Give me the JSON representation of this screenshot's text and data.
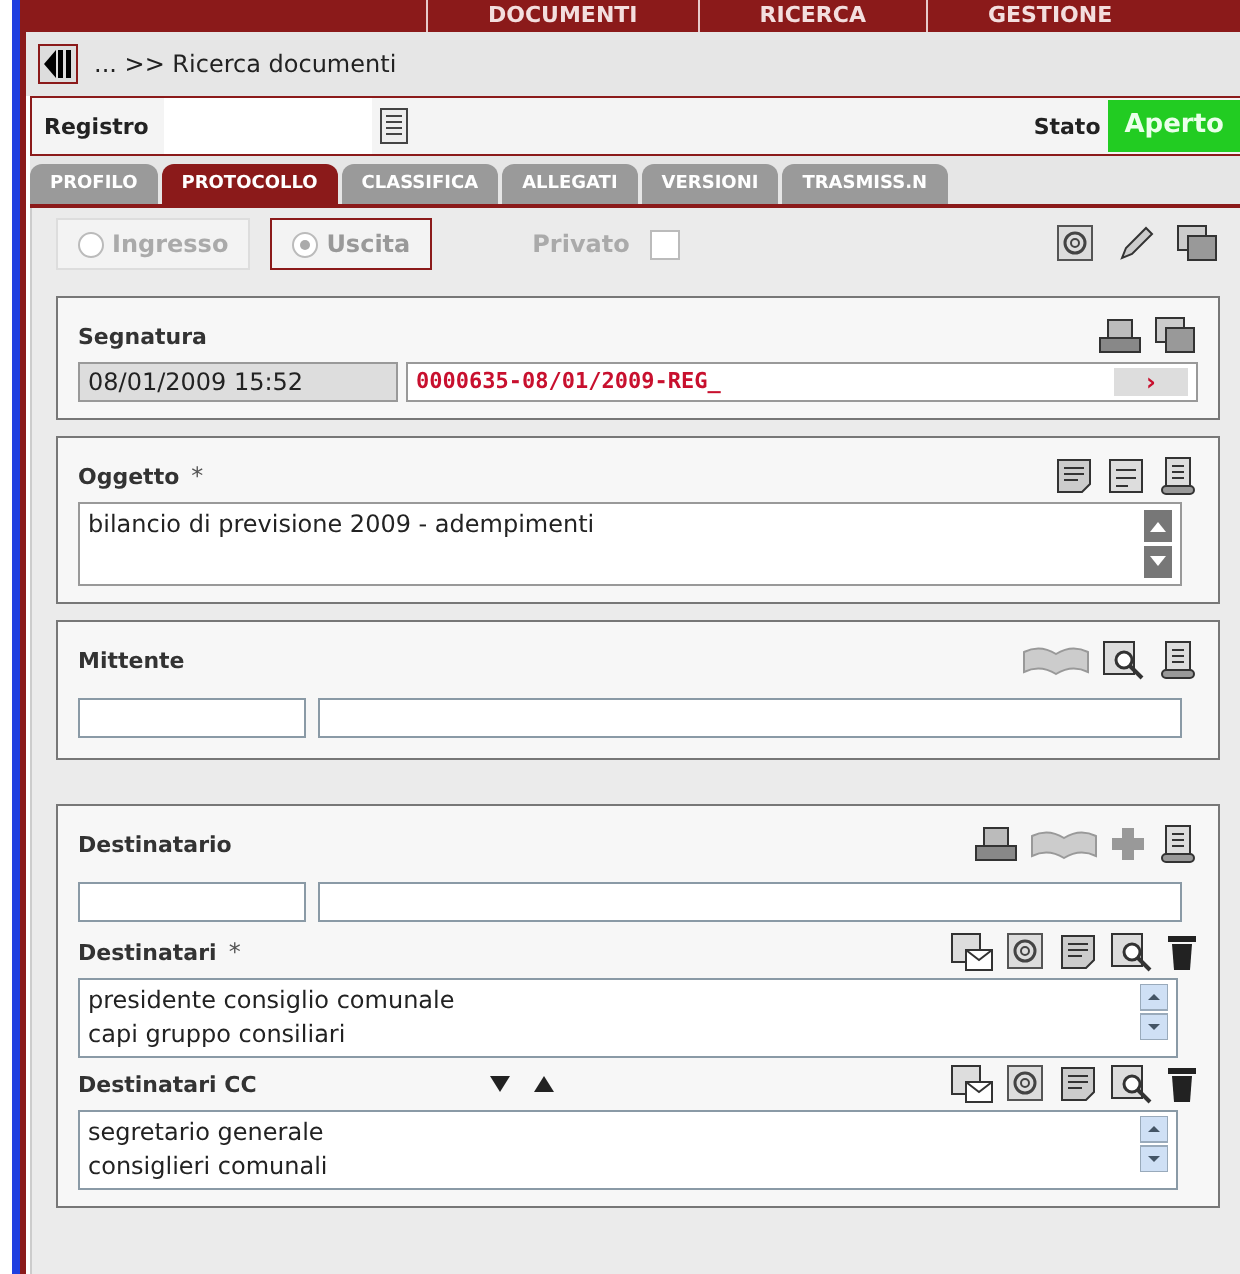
{
  "top_menu": [
    "DOCUMENTI",
    "RICERCA",
    "GESTIONE"
  ],
  "breadcrumb": "... >> Ricerca documenti",
  "registro": {
    "label": "Registro"
  },
  "stato": {
    "label": "Stato",
    "value": "Aperto"
  },
  "tabs": [
    {
      "label": "PROFILO",
      "selected": false
    },
    {
      "label": "PROTOCOLLO",
      "selected": true
    },
    {
      "label": "CLASSIFICA",
      "selected": false
    },
    {
      "label": "ALLEGATI",
      "selected": false
    },
    {
      "label": "VERSIONI",
      "selected": false
    },
    {
      "label": "TRASMISS.N",
      "selected": false
    }
  ],
  "direction": [
    {
      "label": "Ingresso",
      "selected": false
    },
    {
      "label": "Uscita",
      "selected": true
    }
  ],
  "privato": {
    "label": "Privato",
    "checked": false
  },
  "segnatura": {
    "label": "Segnatura",
    "date": "08/01/2009 15:52",
    "number": "0000635-08/01/2009-REG_",
    "marker": "›"
  },
  "oggetto": {
    "label": "Oggetto",
    "required": "*",
    "value": "bilancio di previsione 2009 - adempimenti"
  },
  "mittente": {
    "label": "Mittente"
  },
  "destinatario": {
    "label": "Destinatario"
  },
  "destinatari": {
    "label": "Destinatari",
    "required": "*",
    "items": [
      "presidente consiglio comunale",
      "capi gruppo consiliari"
    ]
  },
  "destinatari_cc": {
    "label": "Destinatari CC",
    "items": [
      "segretario generale",
      "consiglieri comunali"
    ]
  }
}
